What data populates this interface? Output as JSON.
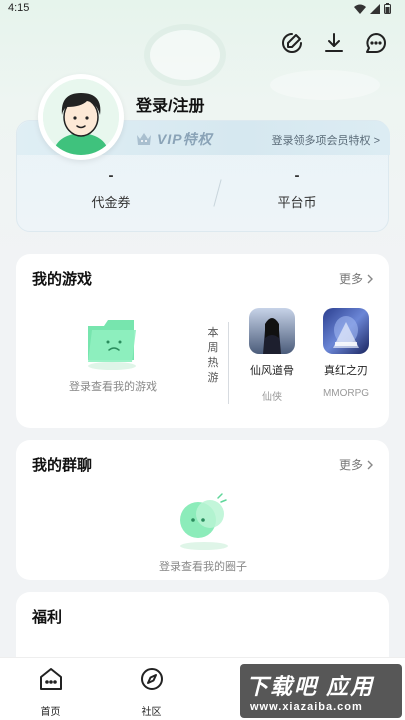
{
  "status_bar": {
    "time": "4:15"
  },
  "profile": {
    "login_label": "登录/注册"
  },
  "vip": {
    "label": "VIP特权",
    "cta": "登录领多项会员特权 >"
  },
  "stats": [
    {
      "value": "-",
      "label": "代金券"
    },
    {
      "value": "-",
      "label": "平台币"
    }
  ],
  "my_games": {
    "title": "我的游戏",
    "more": "更多",
    "empty_text": "登录查看我的游戏",
    "hot_label": "本周热游",
    "games": [
      {
        "name": "仙风道骨",
        "tag": "仙侠"
      },
      {
        "name": "真红之刃",
        "tag": "MMORPG"
      }
    ]
  },
  "my_groups": {
    "title": "我的群聊",
    "more": "更多",
    "empty_text": "登录查看我的圈子"
  },
  "welfare": {
    "title": "福利"
  },
  "bottom_nav": [
    {
      "label": "首页",
      "icon": "home-icon"
    },
    {
      "label": "社区",
      "icon": "compass-icon"
    }
  ],
  "watermark": {
    "main": "下载吧 应用",
    "sub": "www.xiazaiba.com"
  },
  "colors": {
    "accent_green": "#4fd18b",
    "text": "#222222"
  }
}
